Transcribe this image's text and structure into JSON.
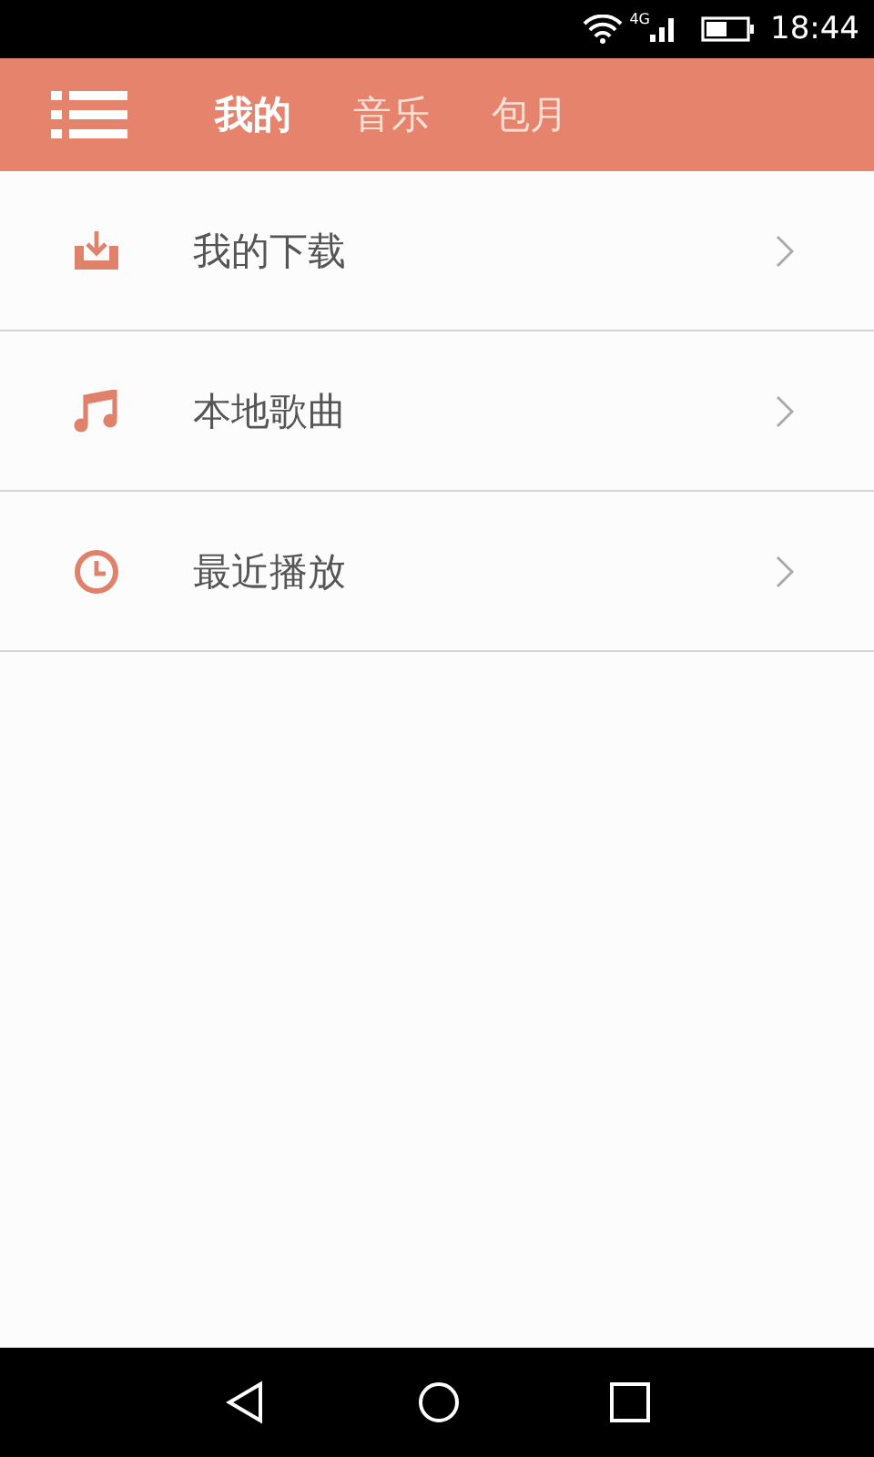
{
  "status_bar": {
    "network": "4G",
    "time": "18:44"
  },
  "tabs": [
    {
      "label": "我的",
      "selected": true
    },
    {
      "label": "音乐",
      "selected": false
    },
    {
      "label": "包月",
      "selected": false
    }
  ],
  "menu_items": [
    {
      "kind": "download",
      "label": "我的下载"
    },
    {
      "kind": "music",
      "label": "本地歌曲"
    },
    {
      "kind": "recent",
      "label": "最近播放"
    }
  ]
}
